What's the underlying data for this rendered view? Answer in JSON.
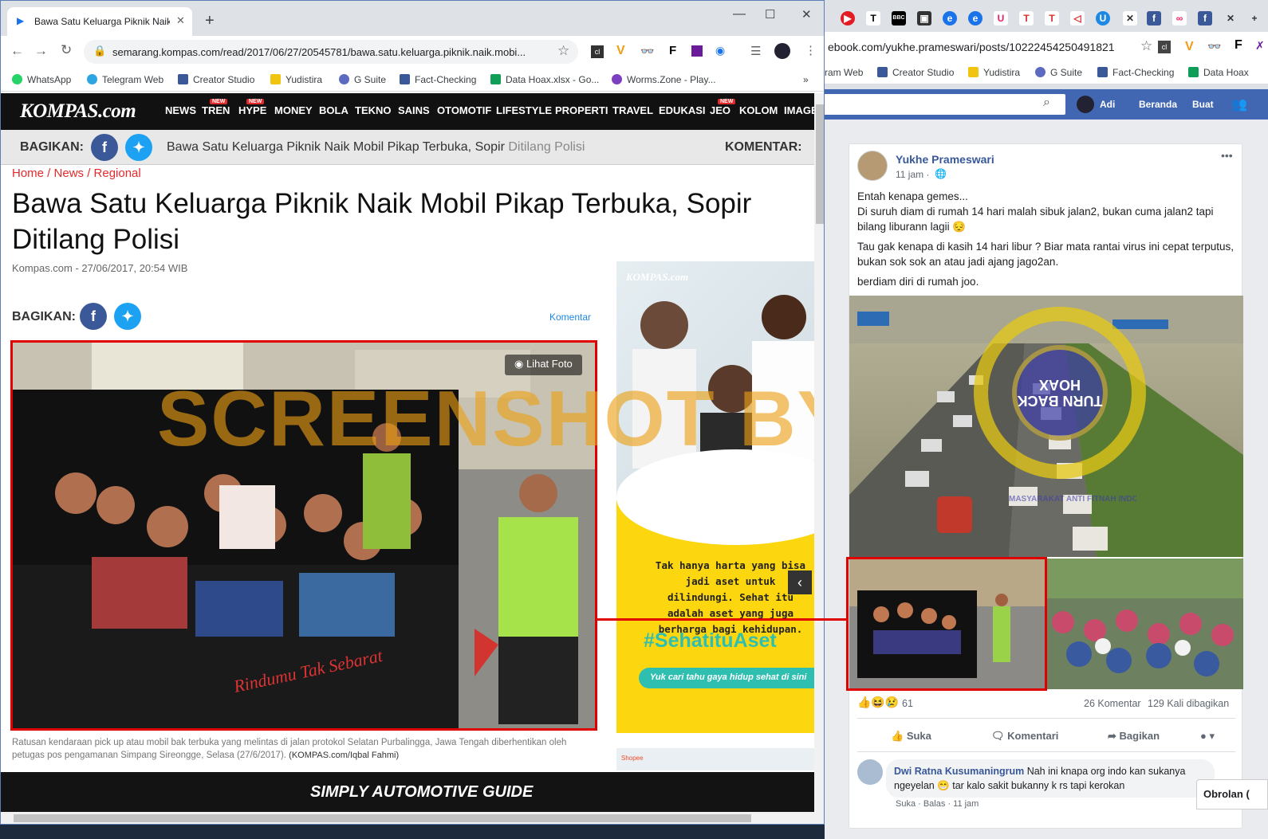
{
  "left_browser": {
    "tab_title": "Bawa Satu Keluarga Piknik Naik M",
    "url": "semarang.kompas.com/read/2017/06/27/20545781/bawa.satu.keluarga.piknik.naik.mobi...",
    "bookmarks": [
      "WhatsApp",
      "Telegram Web",
      "Creator Studio",
      "Yudistira",
      "G Suite",
      "Fact-Checking",
      "Data Hoax.xlsx - Go...",
      "Worms.Zone - Play..."
    ],
    "bookmarks_more": "»"
  },
  "kompas": {
    "logo": "KOMPAS.com",
    "nav": [
      {
        "label": "NEWS",
        "badge": ""
      },
      {
        "label": "TREN",
        "badge": "NEW"
      },
      {
        "label": "HYPE",
        "badge": "NEW"
      },
      {
        "label": "MONEY",
        "badge": ""
      },
      {
        "label": "BOLA",
        "badge": ""
      },
      {
        "label": "TEKNO",
        "badge": ""
      },
      {
        "label": "SAINS",
        "badge": ""
      },
      {
        "label": "OTOMOTIF",
        "badge": ""
      },
      {
        "label": "LIFESTYLE",
        "badge": ""
      },
      {
        "label": "PROPERTI",
        "badge": ""
      },
      {
        "label": "TRAVEL",
        "badge": ""
      },
      {
        "label": "EDUKASI",
        "badge": ""
      },
      {
        "label": "JEO",
        "badge": "NEW"
      },
      {
        "label": "KOLOM",
        "badge": ""
      },
      {
        "label": "IMAGE",
        "badge": ""
      }
    ],
    "share_label": "BAGIKAN:",
    "share_headline_dark": "Bawa Satu Keluarga Piknik Naik Mobil Pikap Terbuka, Sopir ",
    "share_headline_light": "Ditilang Polisi",
    "komentar_label": "KOMENTAR:",
    "breadcrumb": "Home / News / Regional",
    "headline": "Bawa Satu Keluarga Piknik Naik Mobil Pikap Terbuka, Sopir Ditilang Polisi",
    "byline": "Kompas.com - 27/06/2017, 20:54 WIB",
    "share_label2": "BAGIKAN:",
    "komentar_link": "Komentar",
    "lihat_foto": "Lihat Foto",
    "caption": "Ratusan kendaraan pick up atau mobil bak terbuka yang melintas di jalan protokol Selatan Purbalingga, Jawa Tengah diberhentikan oleh petugas pos pengamanan Simpang Sireongge, Selasa (27/6/2017).",
    "caption_credit": "(KOMPAS.com/Iqbal Fahmi)",
    "ad_logo": "KOMPAS.com",
    "ad_text": "Tak hanya harta yang bisa jadi aset untuk dilindungi. Sehat itu adalah aset yang juga berharga bagi kehidupan.",
    "ad_hashtag": "#SehatituAset",
    "ad_button": "Yuk cari tahu gaya hidup sehat di sini",
    "ad_shopee": "Shopee",
    "footer_banner": "SIMPLY AUTOMOTIVE GUIDE",
    "watermark": "SCREENSHOT BY"
  },
  "right_browser": {
    "url": "ebook.com/yukhe.prameswari/posts/10222454250491821",
    "bookmarks": [
      "ram Web",
      "Creator Studio",
      "Yudistira",
      "G Suite",
      "Fact-Checking",
      "Data Hoax"
    ],
    "tab_icons": [
      "youtube-icon",
      "t-icon",
      "bbc-icon",
      "tv-icon",
      "edge-icon",
      "edge-icon",
      "u-icon",
      "t-icon",
      "t-icon",
      "arrow-icon",
      "globe-icon",
      "close-icon",
      "facebook-icon",
      "link-icon",
      "facebook-icon",
      "close-icon"
    ]
  },
  "facebook": {
    "user_name": "Adi",
    "nav_home": "Beranda",
    "nav_create": "Buat",
    "post_author": "Yukhe Prameswari",
    "post_time": "11 jam ·",
    "post_text": [
      "Entah kenapa gemes...",
      "Di suruh diam di rumah 14 hari malah sibuk jalan2, bukan cuma jalan2 tapi bilang liburann lagii 😔",
      "Tau gak kenapa di kasih 14 hari libur ? Biar mata rantai virus ini cepat terputus, bukan sok sok an atau jadi ajang jago2an.",
      "berdiam diri di rumah joo."
    ],
    "stamp_text": "TURN BACK HOAX",
    "stamp_ring": "MASYARAKAT ANTI FITNAH INDONESIA · MAFINDO",
    "reactions_count": "61",
    "comments_count": "26 Komentar",
    "shares_count": "129 Kali dibagikan",
    "btn_like": "Suka",
    "btn_comment": "Komentari",
    "btn_share": "Bagikan",
    "comment_author": "Dwi Ratna Kusumaningrum",
    "comment_text": "Nah ini knapa org indo kan sukanya ngeyelan 😁 tar kalo sakit bukanny k rs tapi kerokan",
    "comment_actions": "Suka · Balas · 11 jam",
    "chat_label": "Obrolan (",
    "more_menu": "•••"
  }
}
